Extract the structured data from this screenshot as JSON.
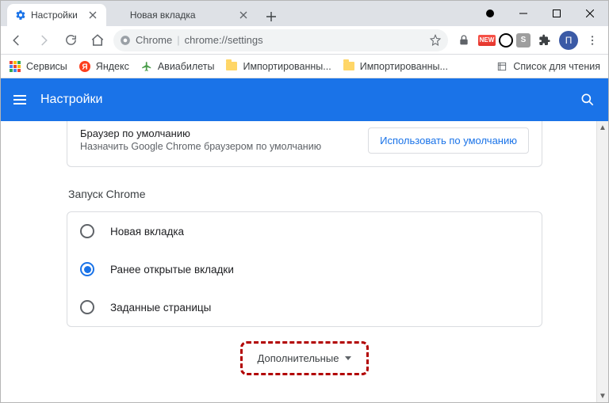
{
  "tabs": [
    {
      "label": "Настройки",
      "active": true
    },
    {
      "label": "Новая вкладка",
      "active": false
    }
  ],
  "toolbar": {
    "omnibox_prefix": "Chrome",
    "url": "chrome://settings",
    "profile_initial": "П"
  },
  "bookmarks": {
    "items": [
      {
        "label": "Сервисы"
      },
      {
        "label": "Яндекс"
      },
      {
        "label": "Авиабилеты"
      },
      {
        "label": "Импортированны..."
      },
      {
        "label": "Импортированны..."
      }
    ],
    "reading_list_label": "Список для чтения"
  },
  "settings": {
    "header_title": "Настройки",
    "default_browser": {
      "title": "Браузер по умолчанию",
      "subtitle": "Назначить Google Chrome браузером по умолчанию",
      "button": "Использовать по умолчанию"
    },
    "startup": {
      "title": "Запуск Chrome",
      "options": [
        {
          "label": "Новая вкладка",
          "selected": false
        },
        {
          "label": "Ранее открытые вкладки",
          "selected": true
        },
        {
          "label": "Заданные страницы",
          "selected": false
        }
      ]
    },
    "advanced_label": "Дополнительные"
  }
}
